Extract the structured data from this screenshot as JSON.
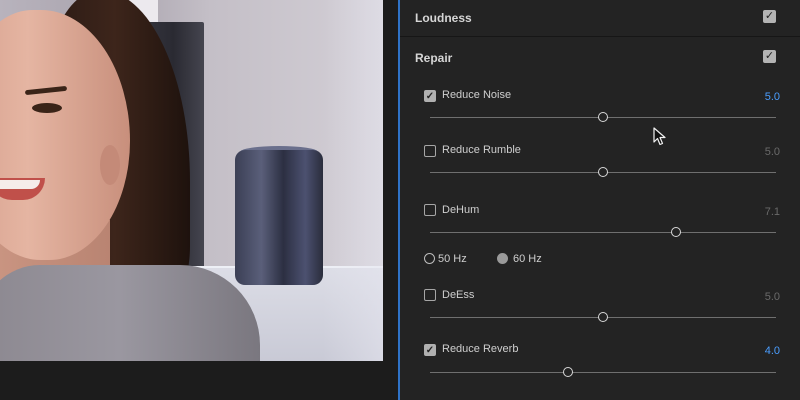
{
  "panel": {
    "loudness": {
      "title": "Loudness",
      "enabled": true
    },
    "repair": {
      "title": "Repair",
      "enabled": true
    },
    "options": [
      {
        "label": "Reduce Noise",
        "checked": true,
        "value": "5.0",
        "level": 0.5
      },
      {
        "label": "Reduce Rumble",
        "checked": false,
        "value": "5.0",
        "level": 0.5
      },
      {
        "label": "DeHum",
        "checked": false,
        "value": "7.1",
        "level": 0.71
      },
      {
        "label": "DeEss",
        "checked": false,
        "value": "5.0",
        "level": 0.5
      },
      {
        "label": "Reduce Reverb",
        "checked": true,
        "value": "4.0",
        "level": 0.4
      }
    ],
    "dehum_freq": {
      "options": [
        "50 Hz",
        "60 Hz"
      ],
      "selected": "60 Hz"
    }
  },
  "colors": {
    "accent_value": "#4a9eff",
    "panel_bg": "#232323",
    "divider": "#2f73c8"
  },
  "icons": {
    "check": "✓",
    "cursor": "mouse-pointer-icon"
  }
}
